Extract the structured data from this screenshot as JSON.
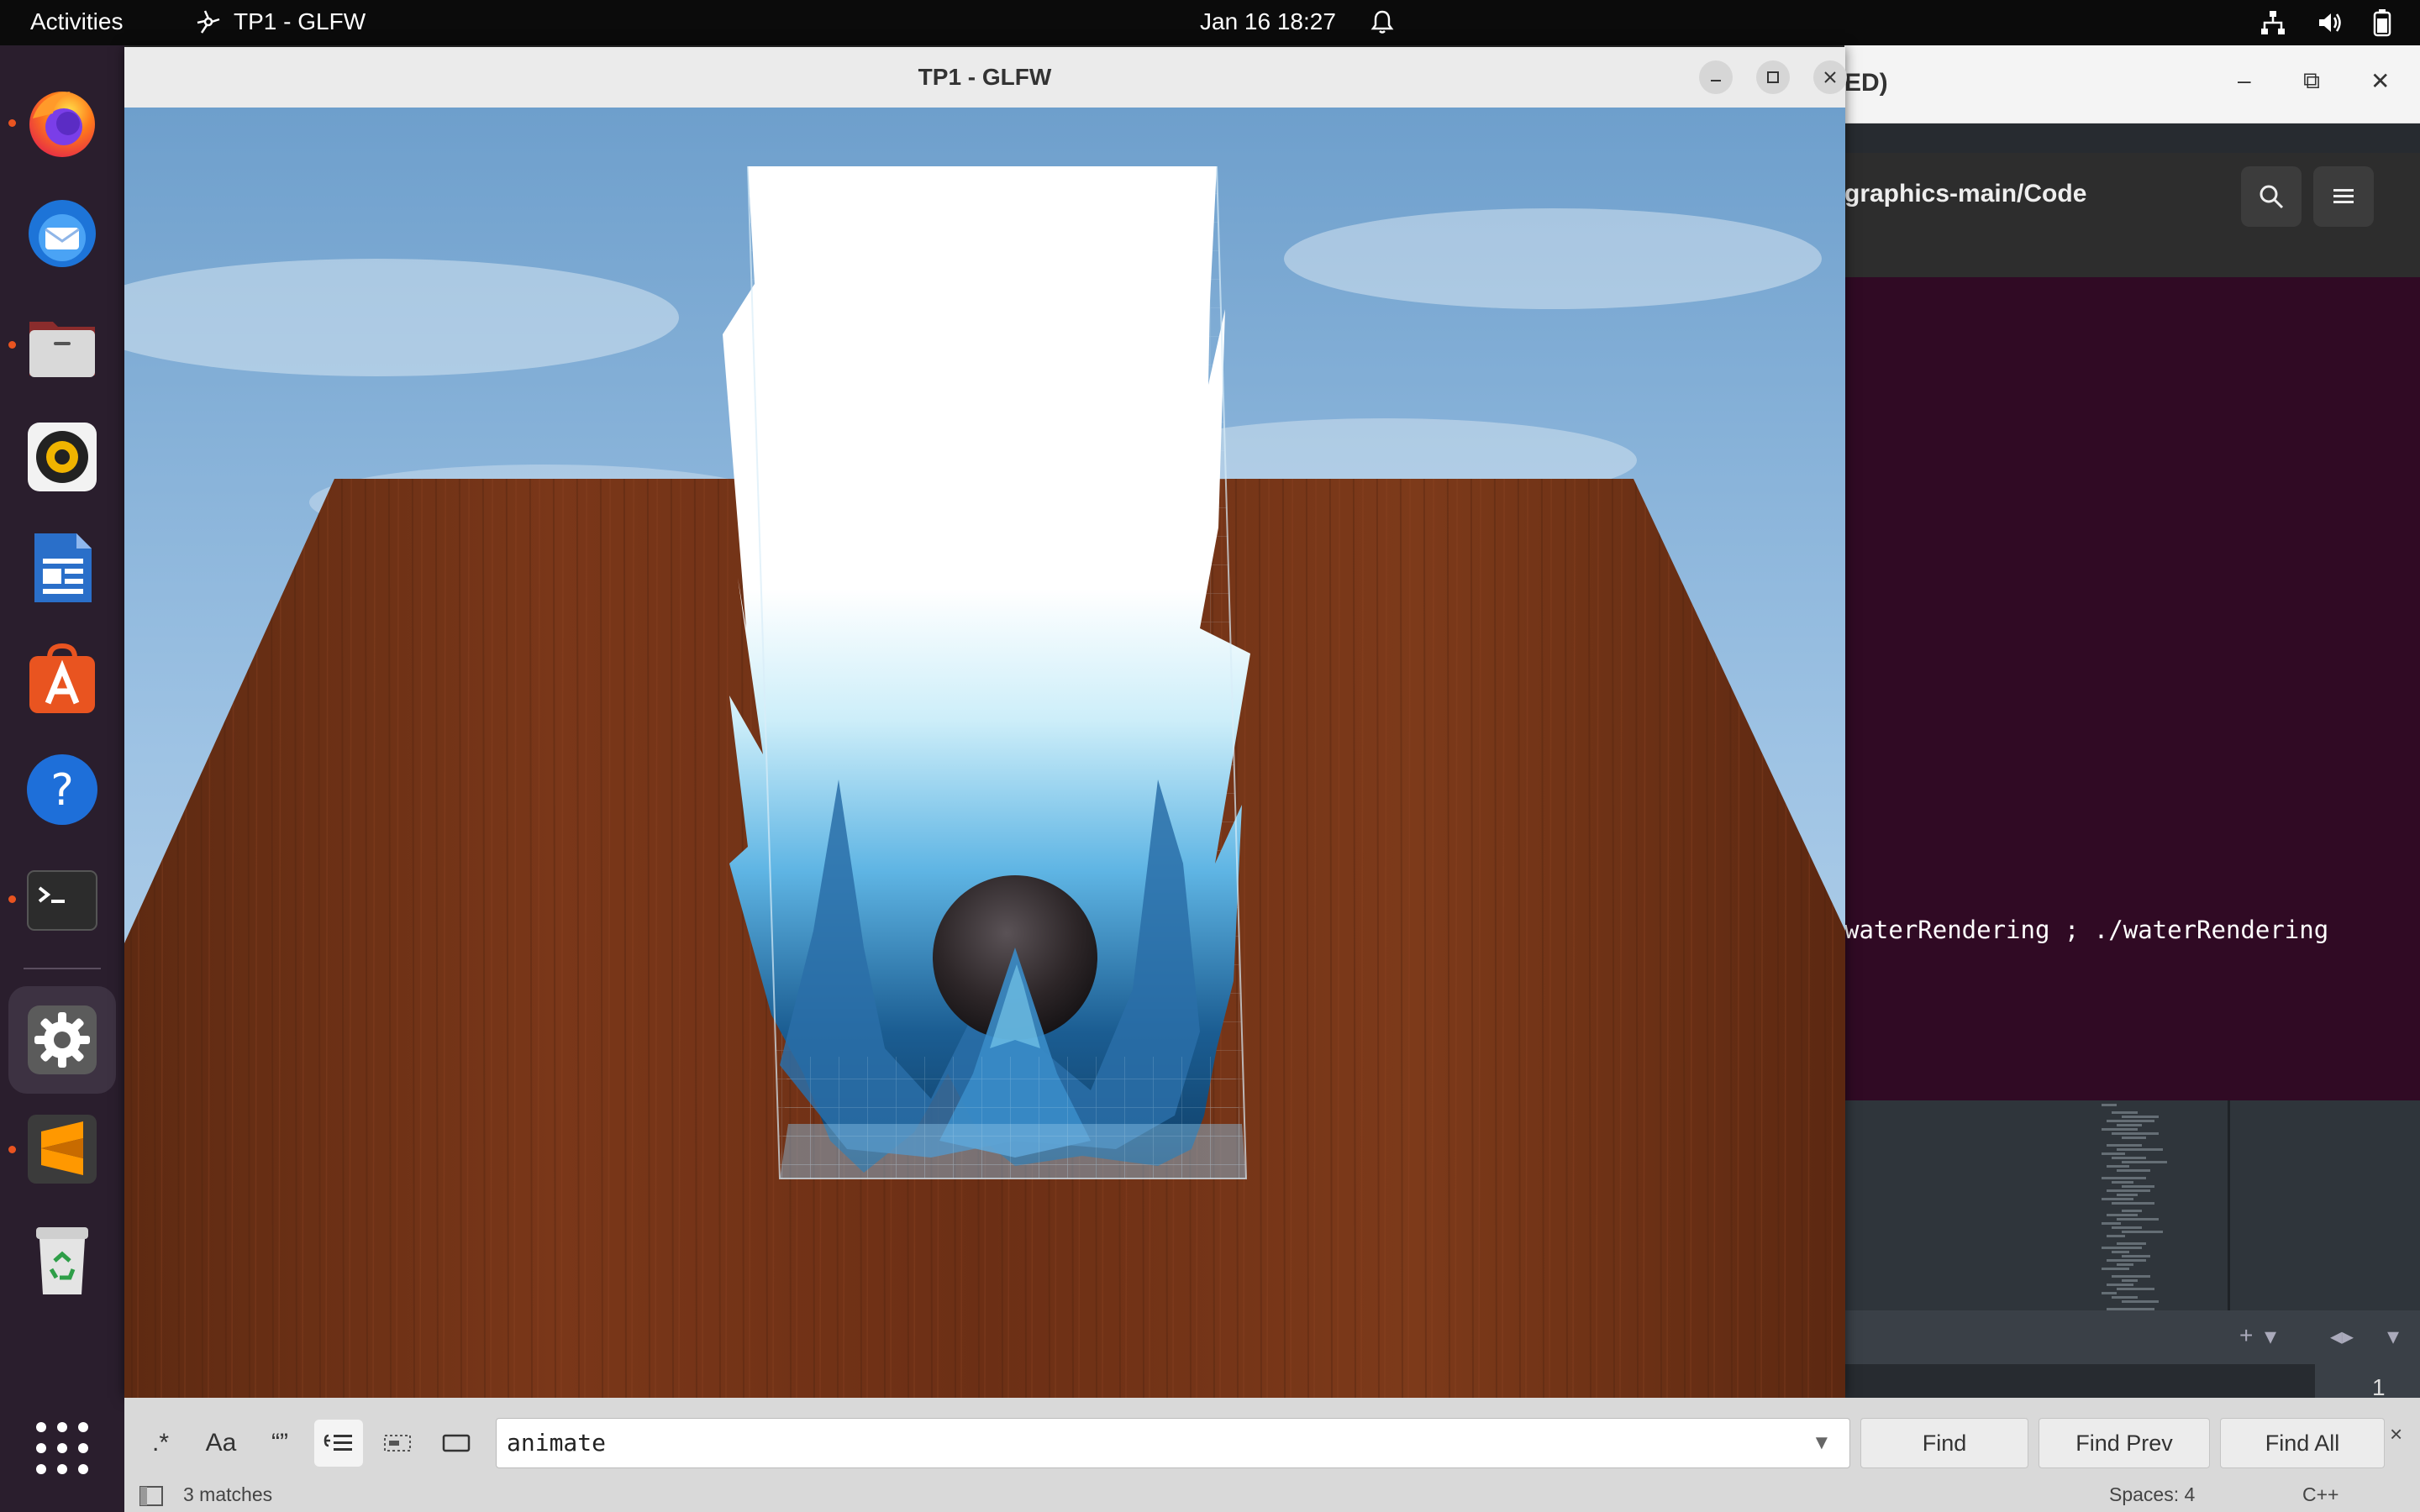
{
  "topbar": {
    "activities": "Activities",
    "app_name": "TP1 - GLFW",
    "datetime": "Jan 16  18:27"
  },
  "dock": {
    "items": [
      {
        "name": "firefox",
        "running": true
      },
      {
        "name": "thunderbird",
        "running": false
      },
      {
        "name": "files",
        "running": true
      },
      {
        "name": "rhythmbox",
        "running": false
      },
      {
        "name": "writer",
        "running": false
      },
      {
        "name": "app-center",
        "running": false
      },
      {
        "name": "help",
        "running": false
      },
      {
        "name": "terminal",
        "running": true
      },
      {
        "name": "settings",
        "running": true
      },
      {
        "name": "sublime-text",
        "running": true
      },
      {
        "name": "trash",
        "running": false
      }
    ],
    "show_apps": "show-apps"
  },
  "glfw_window": {
    "title": "TP1 - GLFW"
  },
  "background_editor": {
    "title_fragment": "ED)",
    "path": "graphics-main/Code",
    "terminal_line": "waterRendering ; ./waterRendering",
    "line_number": "1"
  },
  "findbar": {
    "search_value": "animate",
    "find_label": "Find",
    "find_prev_label": "Find Prev",
    "find_all_label": "Find All",
    "regex_label": ".*",
    "case_label": "Aa",
    "whole_word_label": "“”",
    "close_label": "×"
  },
  "statusbar": {
    "matches": "3 matches",
    "spaces": "Spaces: 4",
    "syntax": "C++"
  },
  "colors": {
    "accent": "#e95420",
    "terminal_bg": "#300a24",
    "dock_bg": "#2a1e2d"
  }
}
